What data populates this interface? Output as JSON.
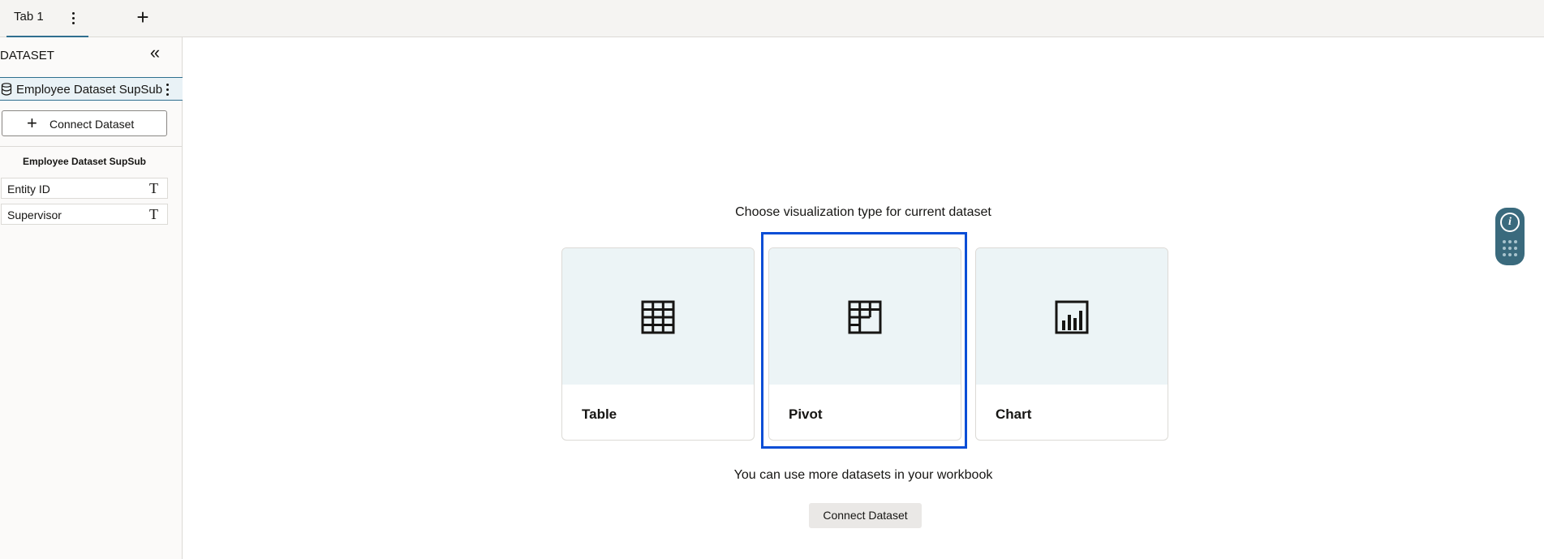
{
  "tabs": {
    "active_label": "Tab 1",
    "add_label": "+"
  },
  "sidebar": {
    "header": "DATASET",
    "collapse_glyph": "«",
    "dataset_item_label": "Employee Dataset SupSub",
    "connect_label": "Connect Dataset",
    "dataset_name": "Employee Dataset SupSub",
    "fields": [
      {
        "label": "Entity ID",
        "type_glyph": "T"
      },
      {
        "label": "Supervisor",
        "type_glyph": "T"
      }
    ]
  },
  "main": {
    "prompt": "Choose visualization type for current dataset",
    "cards": [
      {
        "label": "Table",
        "icon": "table-grid-icon"
      },
      {
        "label": "Pivot",
        "icon": "pivot-table-icon",
        "selected": true
      },
      {
        "label": "Chart",
        "icon": "bar-chart-icon"
      }
    ],
    "more_text": "You can use more datasets in your workbook",
    "connect_label": "Connect Dataset"
  },
  "help": {
    "info_glyph": "i"
  },
  "colors": {
    "accent": "#2f6f8f",
    "selection": "#0a4ed6",
    "card_top": "#ecf4f6",
    "help_widget": "#3a6a7d"
  }
}
